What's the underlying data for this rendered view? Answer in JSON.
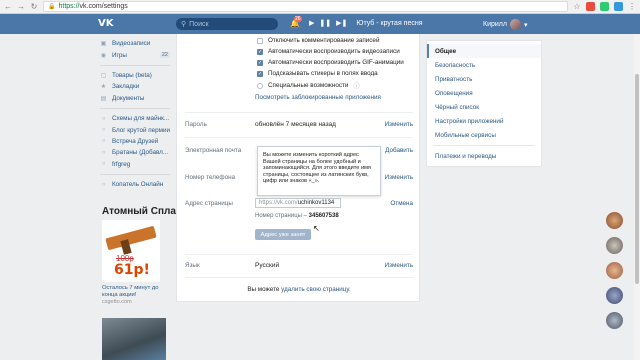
{
  "browser": {
    "https": "https://",
    "url": "vk.com/settings"
  },
  "header": {
    "logo": "VK",
    "search_placeholder": "Поиск",
    "notifications": "26",
    "track": "Ютуб - крутая песня",
    "user": "Кирилл"
  },
  "sidebar": {
    "items": [
      {
        "label": "Видеозаписи",
        "count": ""
      },
      {
        "label": "Игры",
        "count": "22"
      },
      {
        "label": "Товары (beta)",
        "count": ""
      },
      {
        "label": "Закладки",
        "count": ""
      },
      {
        "label": "Документы",
        "count": ""
      },
      {
        "label": "Схемы для майнк...",
        "count": ""
      },
      {
        "label": "Блог крутой пермии",
        "count": ""
      },
      {
        "label": "Встреча Друзей",
        "count": ""
      },
      {
        "label": "Братаны (Добавл...",
        "count": ""
      },
      {
        "label": "frfgreg",
        "count": ""
      },
      {
        "label": "Копатель Онлайн",
        "count": ""
      }
    ]
  },
  "ad": {
    "title": "Атомный Сплав",
    "price_old": "100р",
    "price": "61р!",
    "caption": "Осталось 7 минут до конца акции!",
    "domain": "csgetto.com"
  },
  "settings": {
    "checkboxes": [
      {
        "label": "Отключить комментирование записей",
        "checked": false
      },
      {
        "label": "Автоматически воспроизводить видеозаписи",
        "checked": true
      },
      {
        "label": "Автоматически воспроизводить GIF-анимации",
        "checked": true
      },
      {
        "label": "Подсказывать стикеры в полях ввода",
        "checked": true
      }
    ],
    "accessibility": "Специальные возможности",
    "blocked_apps": "Посмотреть заблокированные приложения",
    "password": {
      "label": "Пароль",
      "value": "обновлён 7 месяцев назад",
      "action": "Изменить"
    },
    "email": {
      "label": "Электронная почта",
      "action": "Добавить"
    },
    "phone": {
      "label": "Номер телефона",
      "action": "Изменить"
    },
    "tooltip": "Вы можете изменить короткий адрес Вашей страницы на более удобный и запоминающийся. Для этого введите имя страницы, состоящее из латинских букв, цифр или знаков «_».",
    "page_address": {
      "label": "Адрес страницы",
      "prefix": "https://vk.com/",
      "value": "uchinkov1134",
      "action": "Отмена",
      "number_label": "Номер страницы –",
      "number": "345607538",
      "button": "Адрес уже занят"
    },
    "language": {
      "label": "Язык",
      "value": "Русский",
      "action": "Изменить"
    },
    "footer_text": "Вы можете",
    "footer_link": "удалить свою страницу."
  },
  "menu": {
    "items": [
      {
        "label": "Общее",
        "active": true
      },
      {
        "label": "Безопасность",
        "active": false
      },
      {
        "label": "Приватность",
        "active": false
      },
      {
        "label": "Оповещения",
        "active": false
      },
      {
        "label": "Чёрный список",
        "active": false
      },
      {
        "label": "Настройки приложений",
        "active": false
      },
      {
        "label": "Мобильные сервисы",
        "active": false
      }
    ],
    "payments": "Платежи и переводы"
  },
  "colors": {
    "header": "#4a76a8",
    "link": "#2a5885",
    "background": "#edeef0"
  }
}
